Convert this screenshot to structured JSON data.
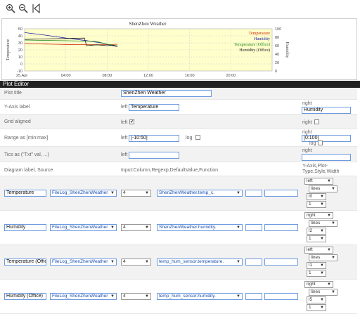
{
  "toolbar": {
    "zoom_in_icon": "zoom-in-icon",
    "zoom_out_icon": "zoom-out-icon",
    "back_icon": "back-icon"
  },
  "chart_data": {
    "type": "line",
    "title": "ShenZhen Weather",
    "ylabel": "Temperature",
    "y2label": "Humidity",
    "ylim": [
      -10,
      50
    ],
    "y2lim": [
      0,
      100
    ],
    "yticks": [
      "50",
      "40",
      "30",
      "20",
      "10",
      "0",
      "-10"
    ],
    "y2ticks": [
      "100",
      "80",
      "60",
      "40",
      "20",
      "0"
    ],
    "xticks": [
      "25.Apr",
      "04:00",
      "08:00",
      "12:00",
      "16:00",
      "20:00"
    ],
    "grid": true,
    "legend_position": "top-right",
    "series": [
      {
        "name": "Temperature",
        "color": "#cc2200",
        "axis": "left",
        "x": [
          0,
          1,
          2,
          3,
          4,
          5,
          6,
          7,
          8,
          8.5,
          9
        ],
        "y": [
          29,
          28.6,
          28.3,
          28.0,
          27.7,
          27.5,
          27.4,
          27.3,
          27.4,
          27.6,
          28
        ]
      },
      {
        "name": "Humidity",
        "color": "#2222aa",
        "axis": "right",
        "x": [
          0,
          2,
          4,
          6,
          7.5,
          8,
          8.5,
          9
        ],
        "y": [
          91,
          85,
          78,
          72,
          66,
          63,
          60,
          58
        ]
      },
      {
        "name": "Temperature (Office)",
        "color": "#228822",
        "axis": "left",
        "x": [
          0,
          2,
          4,
          6,
          7,
          7.5,
          8,
          8.5,
          9
        ],
        "y": [
          34,
          33.5,
          33,
          32.5,
          32,
          30,
          28,
          27,
          25.5
        ]
      },
      {
        "name": "Humidity (Office)",
        "color": "#222222",
        "axis": "right",
        "x": [
          0,
          2,
          4,
          5.8,
          6,
          7,
          8,
          8.5,
          9
        ],
        "y": [
          75,
          76,
          77,
          78,
          60,
          62,
          60,
          61,
          59
        ]
      }
    ]
  },
  "editor": {
    "title": "Plot Editor",
    "plot_title_label": "Plot title",
    "plot_title_value": "ShenZhen Weather",
    "yaxis_label": "Y-Axis label",
    "left_word": "left",
    "right_word": "right",
    "yaxis_left_value": "Temperature",
    "yaxis_right_value": "Humidity",
    "grid_label": "Grid aligned",
    "grid_left_checked": "✔",
    "range_label": "Range as [min:max]",
    "range_left_value": "[-10:50]",
    "range_right_value": "[0:100]",
    "log_word": "log",
    "tics_label": "Tics as (\"Txt\" val, ...)",
    "diagram_label": "Diagram label, Source",
    "input_desc": "Input:Column,Regexp,DefaultValue,Function",
    "yaxis_desc": "Y-Axis,Plot-Type,Style,Width",
    "rows": [
      {
        "label": "Temperature",
        "source": "FileLog_ShenZhenWeather",
        "column": "4",
        "regexp": "ShenZhenWeather.temp_c.",
        "axis": "left",
        "type": "lines",
        "style": "l0",
        "width": "1"
      },
      {
        "label": "Humidity",
        "source": "FileLog_ShenZhenWeather",
        "column": "4",
        "regexp": "ShenZhenWeather.humidity.",
        "axis": "right",
        "type": "lines",
        "style": "l2",
        "width": "1"
      },
      {
        "label": "Temperature (Office)",
        "source": "FileLog_ShenZhenWeather",
        "column": "4",
        "regexp": "temp_hum_sensor.temperature.",
        "axis": "left",
        "type": "lines",
        "style": "l1",
        "width": "1"
      },
      {
        "label": "Humidity (Office)",
        "source": "FileLog_ShenZhenWeather",
        "column": "4",
        "regexp": "temp_hum_sensor.humidity.",
        "axis": "right",
        "type": "lines",
        "style": "l5",
        "width": "1"
      }
    ]
  }
}
